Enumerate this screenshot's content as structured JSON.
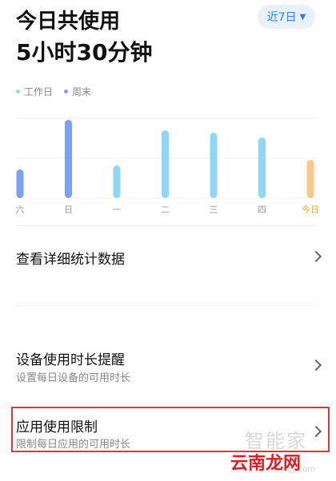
{
  "header": {
    "title": "今日共使用",
    "subtitle": "5小时30分钟",
    "range_label": "近7日"
  },
  "legend": [
    {
      "label": "工作日",
      "color": "#8fd6fb"
    },
    {
      "label": "周末",
      "color": "#7aa0f7"
    }
  ],
  "chart_data": {
    "type": "bar",
    "categories": [
      "六",
      "日",
      "一",
      "二",
      "三",
      "四",
      "今日"
    ],
    "values": [
      0.36,
      0.98,
      0.41,
      0.85,
      0.82,
      0.76,
      0.48
    ],
    "bar_kinds": [
      "weekend",
      "weekend",
      "weekday",
      "weekday",
      "weekday",
      "weekday",
      "today"
    ],
    "colors": {
      "weekday": "#8fd6fb",
      "weekend": "#7aa0f7",
      "today": "#ffc68a",
      "today_label": "#f5a623"
    },
    "gridlines": 3
  },
  "menu": {
    "stats_label": "查看详细统计数据",
    "reminder_title": "设备使用时长提醒",
    "reminder_sub": "设置每日设备的可用时长",
    "limit_title": "应用使用限制",
    "limit_sub": "限制每日应用的可用时长"
  },
  "watermark": {
    "gray_text": "智能家",
    "red_text": "云南龙网",
    "url_text": "ynjy.com"
  }
}
